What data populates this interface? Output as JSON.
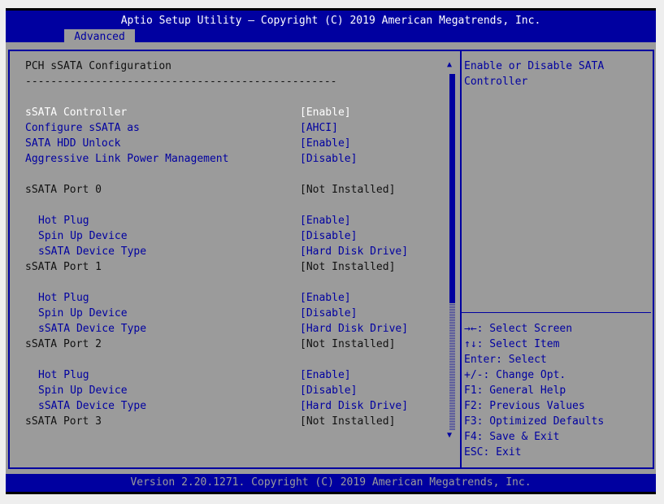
{
  "header": {
    "title": "Aptio Setup Utility – Copyright (C) 2019 American Megatrends, Inc.",
    "tab": "Advanced"
  },
  "main": {
    "title": "PCH sSATA Configuration",
    "separator": "-------------------------------------------------",
    "items": [
      {
        "label": "sSATA Controller",
        "value": "[Enable]"
      },
      {
        "label": "Configure sSATA as",
        "value": "[AHCI]"
      },
      {
        "label": "SATA HDD Unlock",
        "value": "[Enable]"
      },
      {
        "label": "Aggressive Link Power Management",
        "value": "[Disable]"
      },
      {
        "label": "sSATA Port 0",
        "value": "[Not Installed]"
      },
      {
        "label": "Hot Plug",
        "value": "[Enable]"
      },
      {
        "label": "Spin Up Device",
        "value": "[Disable]"
      },
      {
        "label": "sSATA Device Type",
        "value": "[Hard Disk Drive]"
      },
      {
        "label": "sSATA Port 1",
        "value": "[Not Installed]"
      },
      {
        "label": "Hot Plug",
        "value": "[Enable]"
      },
      {
        "label": "Spin Up Device",
        "value": "[Disable]"
      },
      {
        "label": "sSATA Device Type",
        "value": "[Hard Disk Drive]"
      },
      {
        "label": "sSATA Port 2",
        "value": "[Not Installed]"
      },
      {
        "label": "Hot Plug",
        "value": "[Enable]"
      },
      {
        "label": "Spin Up Device",
        "value": "[Disable]"
      },
      {
        "label": "sSATA Device Type",
        "value": "[Hard Disk Drive]"
      },
      {
        "label": "sSATA Port 3",
        "value": "[Not Installed]"
      }
    ]
  },
  "help": {
    "lines": [
      "Enable or Disable SATA",
      "Controller"
    ],
    "keys": [
      "→←: Select Screen",
      "↑↓: Select Item",
      "Enter: Select",
      "+/-: Change Opt.",
      "F1: General Help",
      "F2: Previous Values",
      "F3: Optimized Defaults",
      "F4: Save & Exit",
      "ESC: Exit"
    ]
  },
  "footer": {
    "text": "Version 2.20.1271. Copyright (C) 2019 American Megatrends, Inc."
  }
}
